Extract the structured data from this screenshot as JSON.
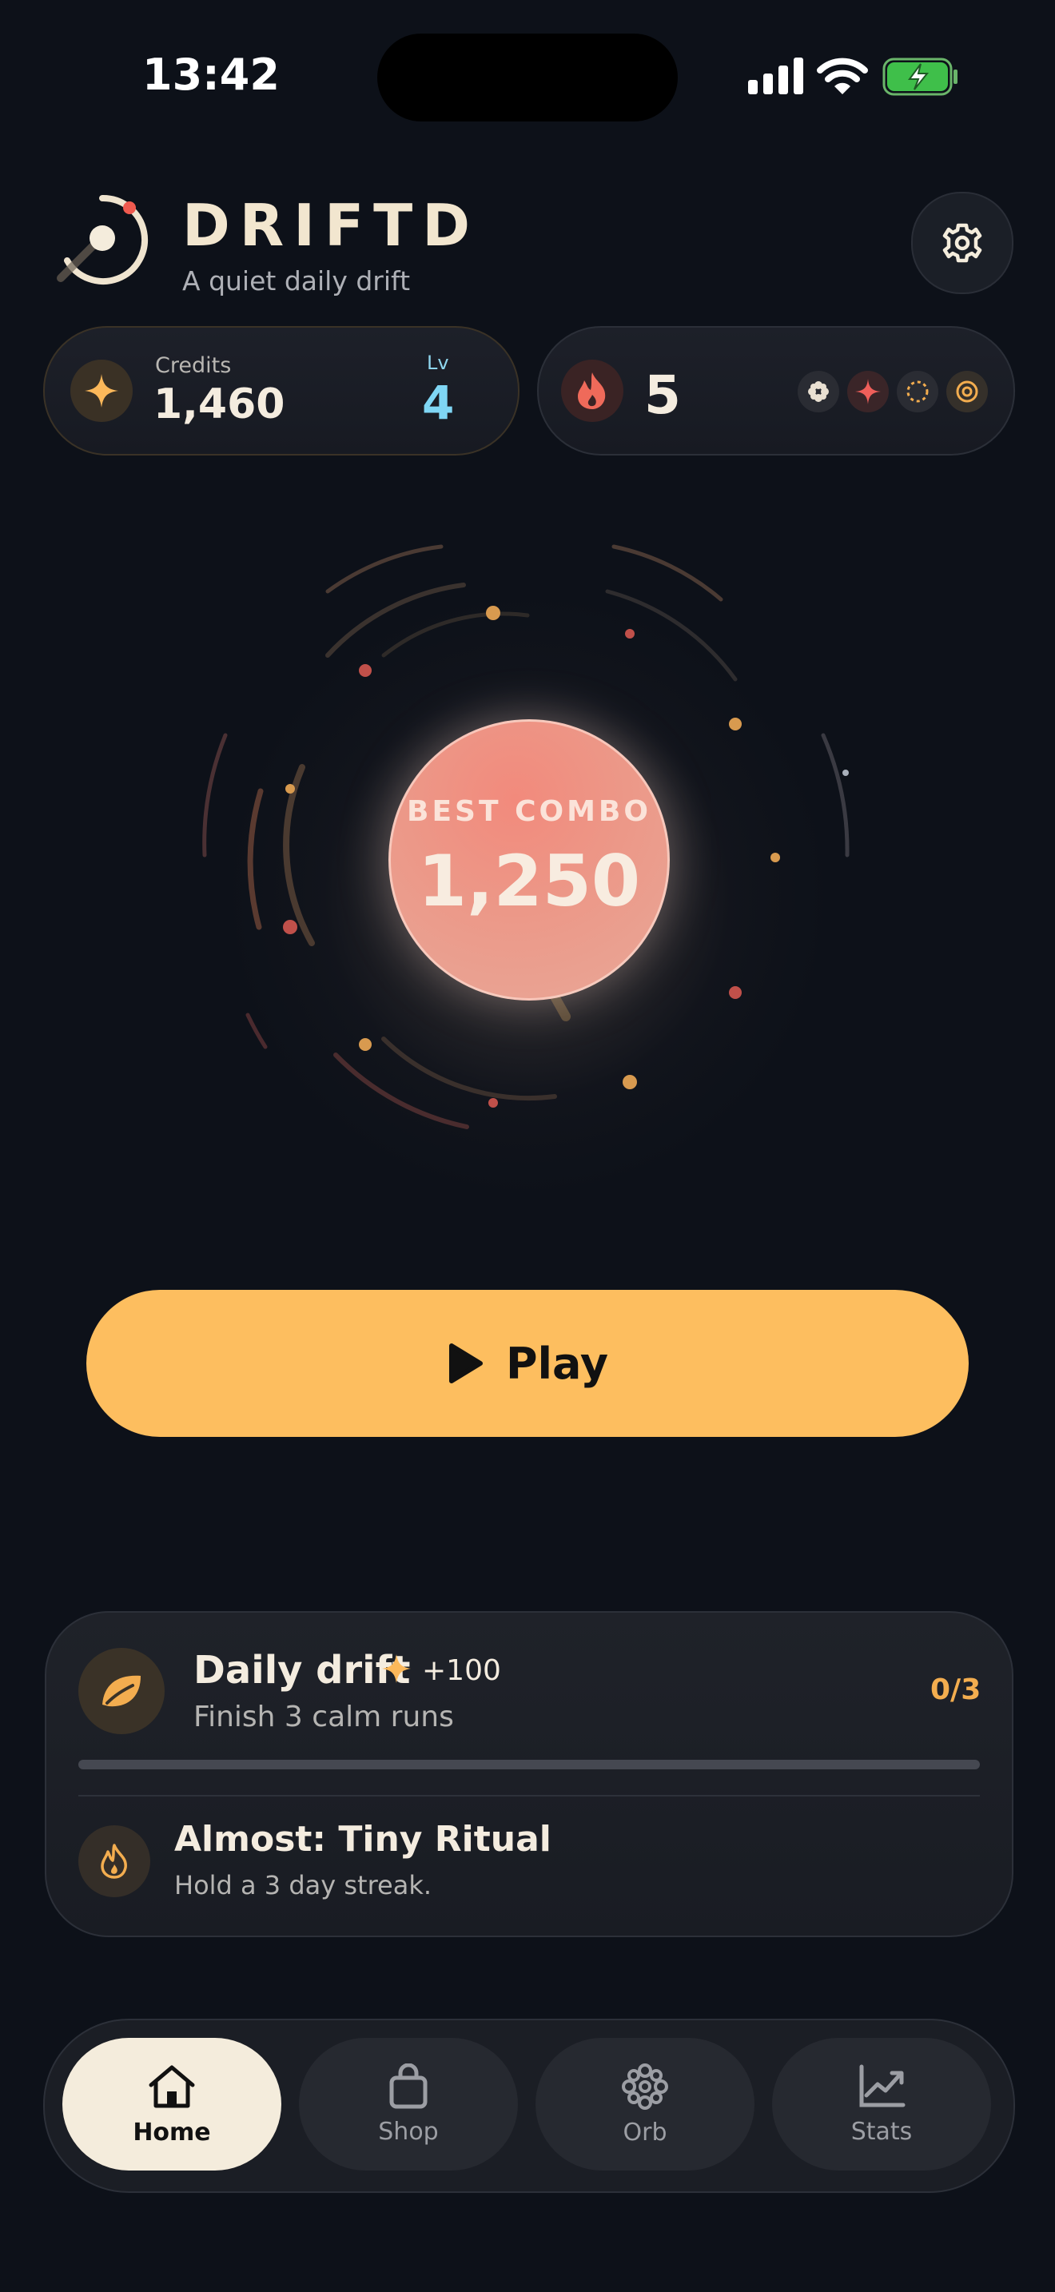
{
  "status_bar": {
    "time": "13:42"
  },
  "header": {
    "title": "DRIFTD",
    "subtitle": "A quiet daily drift"
  },
  "stats": {
    "credits_label": "Credits",
    "credits_value": "1,460",
    "level_label": "Lv",
    "level_value": "4",
    "streak_value": "5",
    "badges": [
      "flower-badge-icon",
      "sparkle-badge-icon",
      "ring-dashed-badge-icon",
      "target-badge-icon"
    ]
  },
  "orb": {
    "label": "BEST COMBO",
    "value": "1,250"
  },
  "play": {
    "label": "Play"
  },
  "daily": {
    "title": "Daily drift",
    "reward": "+100",
    "description": "Finish 3 calm runs",
    "progress_text": "0/3",
    "progress": 0,
    "next_title": "Almost: Tiny Ritual",
    "next_description": "Hold a 3 day streak."
  },
  "tabs": [
    {
      "label": "Home",
      "icon": "home-icon",
      "active": true
    },
    {
      "label": "Shop",
      "icon": "bag-icon",
      "active": false
    },
    {
      "label": "Orb",
      "icon": "orb-icon",
      "active": false
    },
    {
      "label": "Stats",
      "icon": "chart-icon",
      "active": false
    }
  ],
  "colors": {
    "background": "#0d1119",
    "accent": "#fdbe5f",
    "level": "#7fd6f4",
    "orb": "#ec9888",
    "streak": "#ef6a5a"
  }
}
